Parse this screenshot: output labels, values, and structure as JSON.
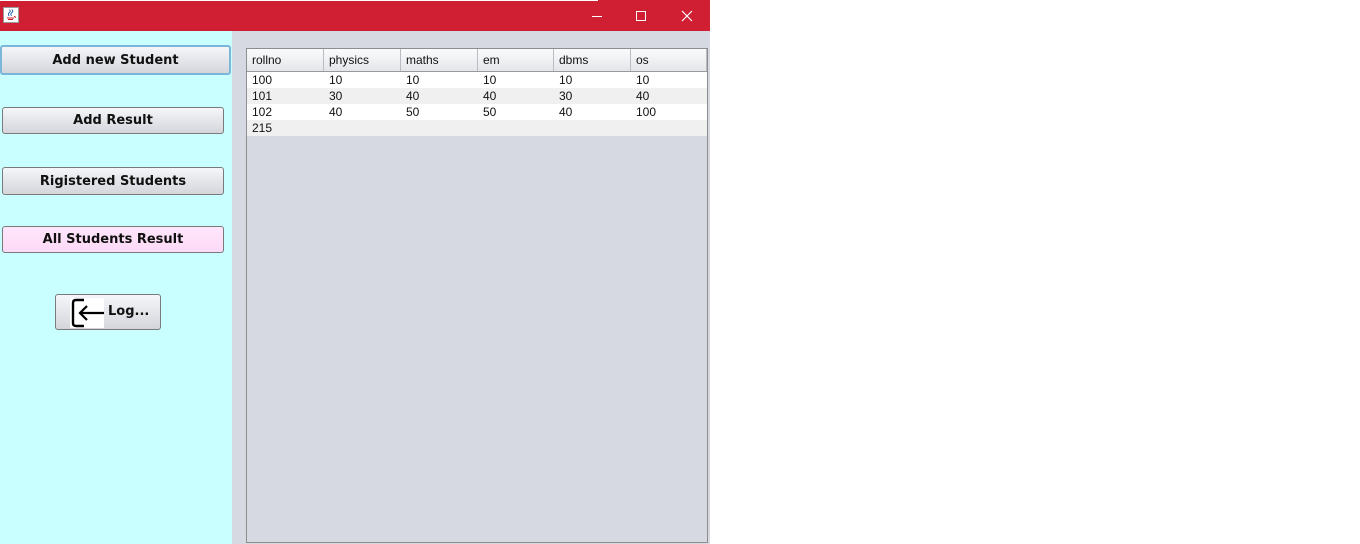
{
  "window": {
    "icons": {
      "app": "java-icon",
      "minimize": "minimize-icon",
      "maximize": "maximize-icon",
      "close": "close-icon"
    },
    "titlebar_color": "#d01f33"
  },
  "sidebar": {
    "add_new_student": "Add new Student",
    "add_result": "Add Result",
    "registered_students": "Rigistered Students",
    "all_students_result": "All Students Result",
    "logout": "Log...",
    "logout_icon": "logout-arrow-icon",
    "background": "#c9ffff",
    "selected_color": "#ffe6fb"
  },
  "table": {
    "columns": [
      "rollno",
      "physics",
      "maths",
      "em",
      "dbms",
      "os"
    ],
    "rows": [
      [
        "100",
        "10",
        "10",
        "10",
        "10",
        "10"
      ],
      [
        "101",
        "30",
        "40",
        "40",
        "30",
        "40"
      ],
      [
        "102",
        "40",
        "50",
        "50",
        "40",
        "100"
      ],
      [
        "215",
        "",
        "",
        "",
        "",
        ""
      ]
    ]
  }
}
